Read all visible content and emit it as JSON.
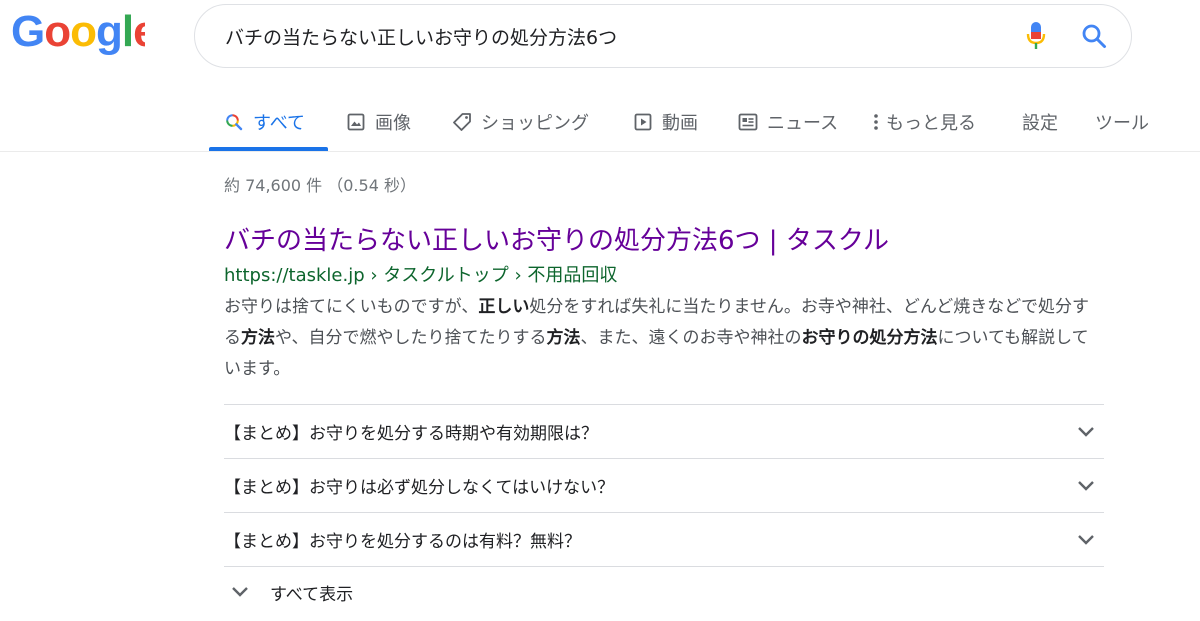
{
  "header": {
    "logo_text": "Google",
    "search_value": "バチの当たらない正しいお守りの処分方法6つ"
  },
  "tabs": [
    {
      "label": "すべて",
      "icon": "search-icon",
      "active": true
    },
    {
      "label": "画像",
      "icon": "image-icon"
    },
    {
      "label": "ショッピング",
      "icon": "tag-icon"
    },
    {
      "label": "動画",
      "icon": "play-icon"
    },
    {
      "label": "ニュース",
      "icon": "news-icon"
    },
    {
      "label": "もっと見る",
      "icon": "more-vert-icon"
    },
    {
      "label": "設定"
    },
    {
      "label": "ツール"
    }
  ],
  "result_stats": "約 74,600 件 （0.54 秒）",
  "result": {
    "title": "バチの当たらない正しいお守りの処分方法6つ | タスクル",
    "url": "https://taskle.jp › タスクルトップ › 不用品回収",
    "snippet": [
      {
        "text": "お守りは捨てにくいものですが、",
        "bold": false
      },
      {
        "text": "正しい",
        "bold": true
      },
      {
        "text": "処分をすれば失礼に当たりません。お寺や神社、どんど焼きなどで処分する",
        "bold": false
      },
      {
        "text": "方法",
        "bold": true
      },
      {
        "text": "や、自分で燃やしたり捨てたりする",
        "bold": false
      },
      {
        "text": "方法",
        "bold": true
      },
      {
        "text": "、また、遠くのお寺や神社の",
        "bold": false
      },
      {
        "text": "お守りの処分方法",
        "bold": true
      },
      {
        "text": "についても解説しています。",
        "bold": false
      }
    ]
  },
  "faq": [
    "【まとめ】お守りを処分する時期や有効期限は？",
    "【まとめ】お守りは必ず処分しなくてはいけない？",
    "【まとめ】お守りを処分するのは有料？無料？"
  ],
  "show_all": "すべて表示",
  "colors": {
    "accent": "#1a73e8",
    "visited_link": "#660099",
    "url_green": "#0d652d",
    "logo_blue": "#4285f4",
    "logo_red": "#ea4335",
    "logo_yellow": "#fbbc05",
    "logo_green": "#34a853"
  }
}
